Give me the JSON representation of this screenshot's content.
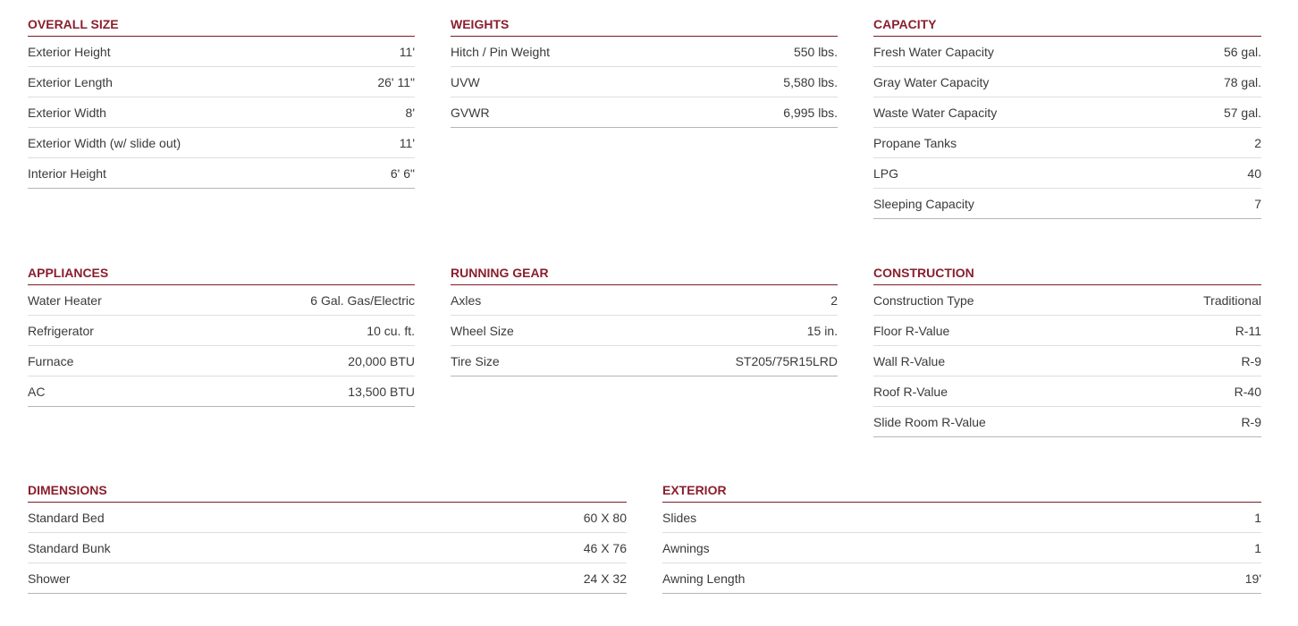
{
  "sections": [
    {
      "title": "OVERALL SIZE",
      "rows": [
        {
          "label": "Exterior Height",
          "value": "11'"
        },
        {
          "label": "Exterior Length",
          "value": "26' 11\""
        },
        {
          "label": "Exterior Width",
          "value": "8'"
        },
        {
          "label": "Exterior Width (w/ slide out)",
          "value": "11'"
        },
        {
          "label": "Interior Height",
          "value": "6' 6\""
        }
      ]
    },
    {
      "title": "WEIGHTS",
      "rows": [
        {
          "label": "Hitch / Pin Weight",
          "value": "550 lbs."
        },
        {
          "label": "UVW",
          "value": "5,580 lbs."
        },
        {
          "label": "GVWR",
          "value": "6,995 lbs."
        }
      ]
    },
    {
      "title": "CAPACITY",
      "rows": [
        {
          "label": "Fresh Water Capacity",
          "value": "56 gal."
        },
        {
          "label": "Gray Water Capacity",
          "value": "78 gal."
        },
        {
          "label": "Waste Water Capacity",
          "value": "57 gal."
        },
        {
          "label": "Propane Tanks",
          "value": "2"
        },
        {
          "label": "LPG",
          "value": "40"
        },
        {
          "label": "Sleeping Capacity",
          "value": "7"
        }
      ]
    },
    {
      "title": "APPLIANCES",
      "rows": [
        {
          "label": "Water Heater",
          "value": "6 Gal. Gas/Electric"
        },
        {
          "label": "Refrigerator",
          "value": "10 cu. ft."
        },
        {
          "label": "Furnace",
          "value": "20,000 BTU"
        },
        {
          "label": "AC",
          "value": "13,500 BTU"
        }
      ]
    },
    {
      "title": "RUNNING GEAR",
      "rows": [
        {
          "label": "Axles",
          "value": "2"
        },
        {
          "label": "Wheel Size",
          "value": "15 in."
        },
        {
          "label": "Tire Size",
          "value": "ST205/75R15LRD"
        }
      ]
    },
    {
      "title": "CONSTRUCTION",
      "rows": [
        {
          "label": "Construction Type",
          "value": "Traditional"
        },
        {
          "label": "Floor R-Value",
          "value": "R-11"
        },
        {
          "label": "Wall R-Value",
          "value": "R-9"
        },
        {
          "label": "Roof R-Value",
          "value": "R-40"
        },
        {
          "label": "Slide Room R-Value",
          "value": "R-9"
        }
      ]
    },
    {
      "title": "DIMENSIONS",
      "rows": [
        {
          "label": "Standard Bed",
          "value": "60 X 80"
        },
        {
          "label": "Standard Bunk",
          "value": "46 X 76"
        },
        {
          "label": "Shower",
          "value": "24 X 32"
        }
      ]
    },
    {
      "title": "EXTERIOR",
      "rows": [
        {
          "label": "Slides",
          "value": "1"
        },
        {
          "label": "Awnings",
          "value": "1"
        },
        {
          "label": "Awning Length",
          "value": "19'"
        }
      ]
    }
  ]
}
